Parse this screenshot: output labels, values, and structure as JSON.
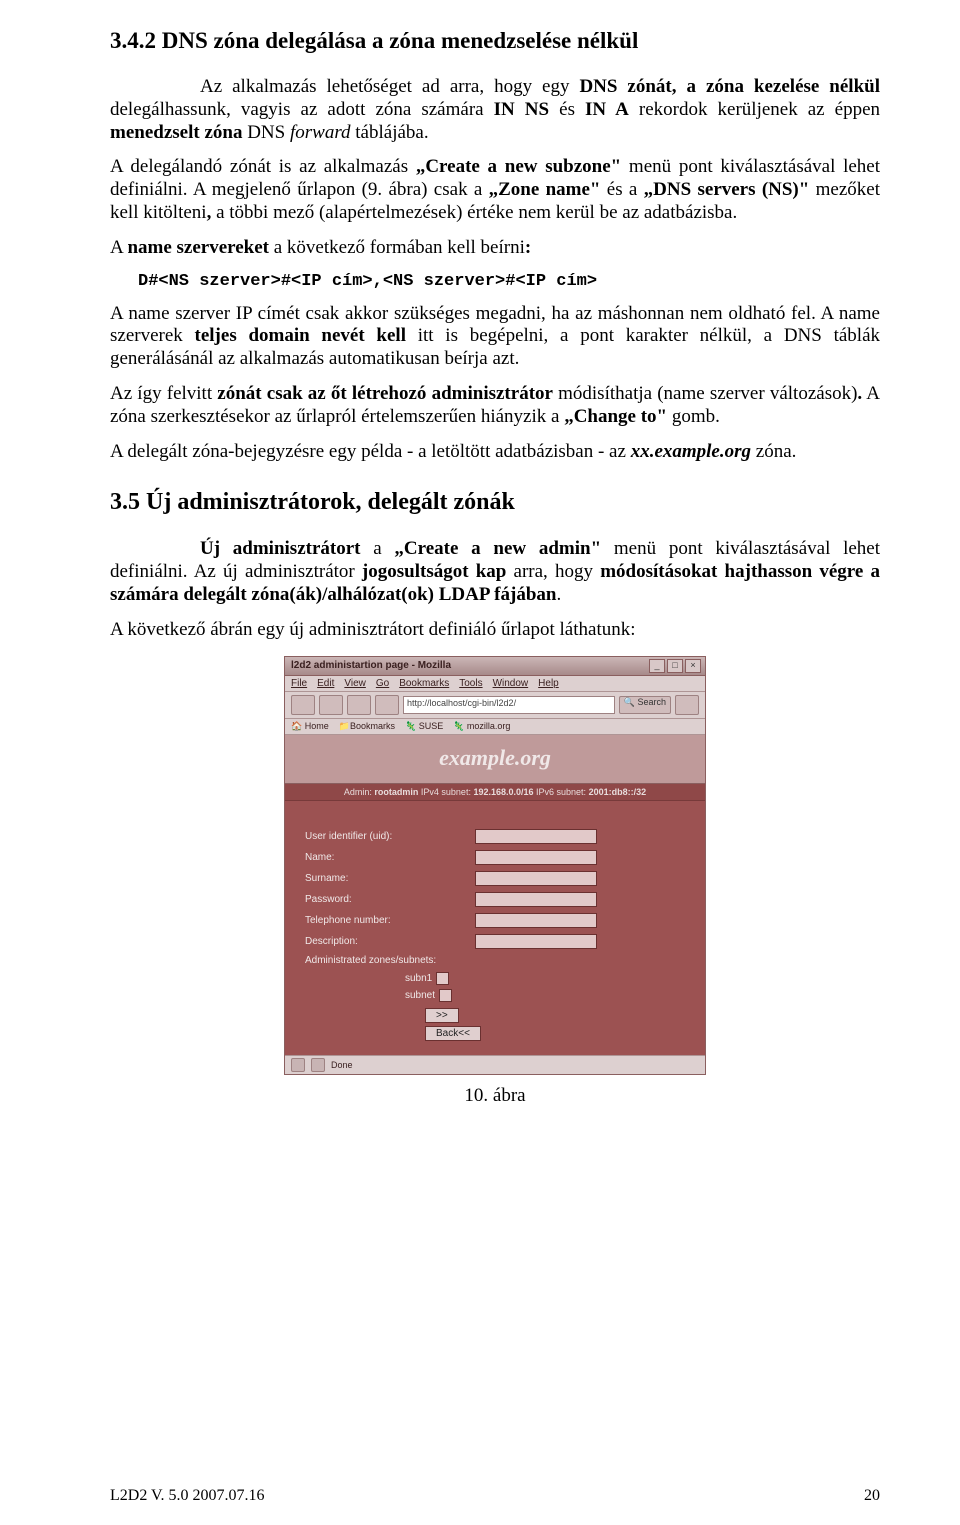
{
  "sections": {
    "s342_title": "3.4.2 DNS zóna delegálása a zóna menedzselése nélkül",
    "s35_title": "3.5 Új adminisztrátorok, delegált zónák"
  },
  "paragraphs": {
    "p1_pre": "Az alkalmazás lehetőséget ad arra, hogy egy ",
    "p1_b1": "DNS zónát, a zóna kezelése nélkül",
    "p1_mid1": " delegálhassunk, vagyis az adott zóna számára ",
    "p1_b2": "IN NS",
    "p1_mid2": " és  ",
    "p1_b3": "IN A",
    "p1_mid3": " rekordok kerüljenek  az éppen ",
    "p1_b4": "menedzselt zóna",
    "p1_mid4": " DNS ",
    "p1_i1": "forward",
    "p1_end": " táblájába.",
    "p2_pre": "A delegálandó zónát is az alkalmazás ",
    "p2_b1": "„Create a new subzone\"",
    "p2_mid1": " menü pont kiválasztásával lehet definiálni. A megjelenő űrlapon (9. ábra) csak a ",
    "p2_b2": "„Zone name\"",
    "p2_mid2": " és a ",
    "p2_b3": "„DNS servers (NS)\"",
    "p2_mid3": " mezőket kell kitölteni",
    "p2_b4": ",",
    "p2_end": " a többi mező (alapértelmezések) értéke nem kerül be az adatbázisba.",
    "p3_pre": "A ",
    "p3_b1": "name szervereket",
    "p3_mid": " a következő formában kell beírni",
    "p3_end": ":",
    "code": "D#<NS szerver>#<IP cím>,<NS szerver>#<IP cím>",
    "p4_pre": "A name szerver IP címét csak akkor szükséges megadni, ha az máshonnan nem oldható fel. A name szerverek ",
    "p4_b1": "teljes domain nevét kell",
    "p4_mid": " itt is begépelni, a pont karakter nélkül, a DNS táblák generálásánál az alkalmazás automatikusan beírja azt.",
    "p5_pre": "Az így felvitt ",
    "p5_b1": "zónát csak az őt létrehozó adminisztrátor",
    "p5_mid1": " módisíthatja (name szerver változások)",
    "p5_dot": ".",
    "p5_mid2": " A zóna szerkesztésekor az űrlapról értelemszerűen hiányzik a ",
    "p5_b2": "„Change to\"",
    "p5_end": " gomb.",
    "p6_pre": "A delegált zóna-bejegyzésre egy példa - a letöltött adatbázisban - az  ",
    "p6_i1": "xx.example.org",
    "p6_end": " zóna.",
    "p7_pre": "Új adminisztrátort",
    "p7_mid1": " a ",
    "p7_b1": "„Create a new admin\"",
    "p7_mid2": " menü pont kiválasztásával lehet definiálni. Az új adminisztrátor ",
    "p7_b2": "jogosultságot kap",
    "p7_mid3": " arra, hogy ",
    "p7_b3": "módosításokat hajthasson végre a számára delegált zóna(ák)/alhálózat(ok) LDAP fájában",
    "p7_end": ".",
    "p8": "A következő ábrán egy új adminisztrátort definiáló űrlapot láthatunk:"
  },
  "screenshot": {
    "window_title": "l2d2 administartion page - Mozilla",
    "menu": {
      "file": "File",
      "edit": "Edit",
      "view": "View",
      "go": "Go",
      "bookmarks": "Bookmarks",
      "tools": "Tools",
      "window": "Window",
      "help": "Help"
    },
    "url": "http://localhost/cgi-bin/l2d2/",
    "search_btn": "Search",
    "bookmarks": {
      "home": "Home",
      "bm": "Bookmarks",
      "suse": "SUSE",
      "moz": "mozilla.org"
    },
    "domain": "example.org",
    "admin_line_pre": "Admin: ",
    "admin_line_b1": "rootadmin",
    "admin_line_mid1": "  IPv4 subnet: ",
    "admin_line_b2": "192.168.0.0/16",
    "admin_line_mid2": "  IPv6 subnet: ",
    "admin_line_b3": "2001:db8::/32",
    "labels": {
      "uid": "User identifier (uid):",
      "name": "Name:",
      "surname": "Surname:",
      "password": "Password:",
      "tel": "Telephone number:",
      "desc": "Description:",
      "admzones": "Administrated zones/subnets:"
    },
    "checks": {
      "subn1": "subn1",
      "subnet": "subnet"
    },
    "buttons": {
      "fwd": ">>",
      "back": "Back<<"
    },
    "status": "Done"
  },
  "caption": "10. ábra",
  "footer": {
    "left": "L2D2 V. 5.0  2007.07.16",
    "right": "20"
  }
}
